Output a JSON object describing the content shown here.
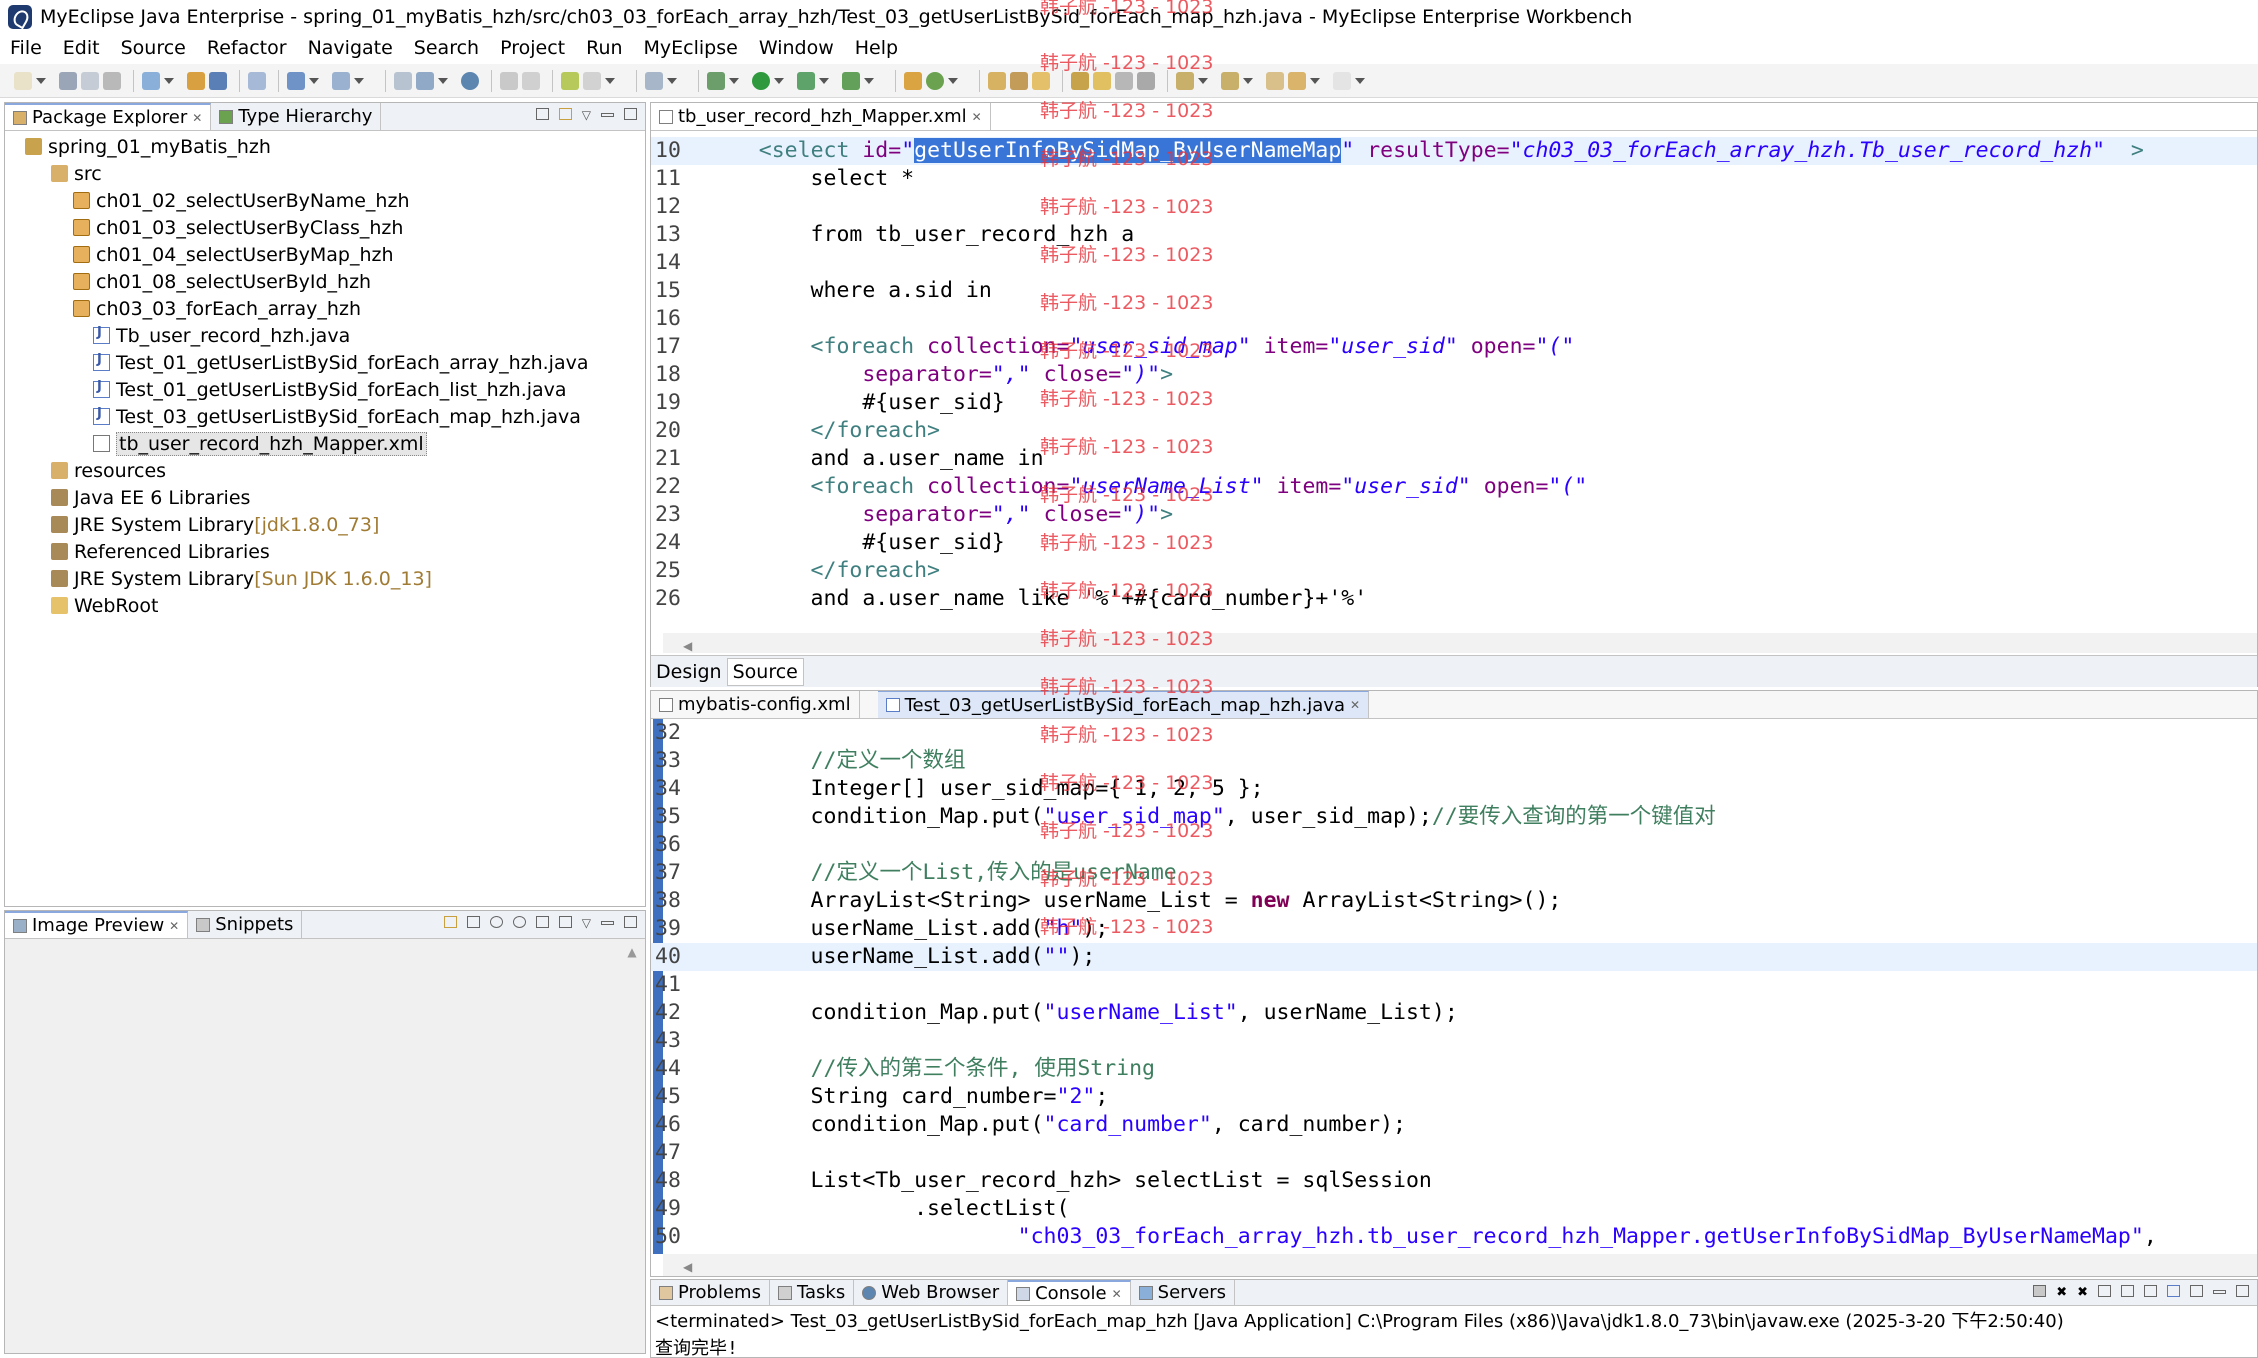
{
  "window": {
    "title": "MyEclipse Java Enterprise - spring_01_myBatis_hzh/src/ch03_03_forEach_array_hzh/Test_03_getUserListBySid_forEach_map_hzh.java - MyEclipse Enterprise Workbench"
  },
  "menu": [
    "File",
    "Edit",
    "Source",
    "Refactor",
    "Navigate",
    "Search",
    "Project",
    "Run",
    "MyEclipse",
    "Window",
    "Help"
  ],
  "explorer": {
    "tabs": [
      "Package Explorer",
      "Type Hierarchy"
    ],
    "tree": [
      {
        "label": "spring_01_myBatis_hzh",
        "extra": ""
      },
      {
        "label": "src",
        "extra": ""
      },
      {
        "label": "ch01_02_selectUserByName_hzh",
        "extra": ""
      },
      {
        "label": "ch01_03_selectUserByClass_hzh",
        "extra": ""
      },
      {
        "label": "ch01_04_selectUserByMap_hzh",
        "extra": ""
      },
      {
        "label": "ch01_08_selectUserById_hzh",
        "extra": ""
      },
      {
        "label": "ch03_03_forEach_array_hzh",
        "extra": ""
      },
      {
        "label": "Tb_user_record_hzh.java",
        "extra": ""
      },
      {
        "label": "Test_01_getUserListBySid_forEach_array_hzh.java",
        "extra": ""
      },
      {
        "label": "Test_01_getUserListBySid_forEach_list_hzh.java",
        "extra": ""
      },
      {
        "label": "Test_03_getUserListBySid_forEach_map_hzh.java",
        "extra": ""
      },
      {
        "label": "tb_user_record_hzh_Mapper.xml",
        "extra": ""
      },
      {
        "label": "resources",
        "extra": ""
      },
      {
        "label": "Java EE 6 Libraries",
        "extra": ""
      },
      {
        "label": "JRE System Library",
        "extra": " [jdk1.8.0_73]"
      },
      {
        "label": "Referenced Libraries",
        "extra": ""
      },
      {
        "label": "JRE System Library",
        "extra": " [Sun JDK 1.6.0_13]"
      },
      {
        "label": "WebRoot",
        "extra": ""
      }
    ]
  },
  "preview": {
    "tabs": [
      "Image Preview",
      "Snippets"
    ]
  },
  "xml_editor": {
    "tab": "tb_user_record_hzh_Mapper.xml",
    "bottom_tabs": [
      "Design",
      "Source"
    ],
    "lines": [
      {
        "n": "10",
        "segs": [
          [
            "",
            ""
          ],
          [
            "xtag",
            "    <"
          ],
          [
            "xtag",
            "select"
          ],
          [
            "xattr",
            " id="
          ],
          [
            "xval",
            "\""
          ],
          [
            "sel",
            "getUserInfoBySidMap_ByUserNameMap"
          ],
          [
            "xval",
            "\""
          ],
          [
            "xattr",
            " resultType="
          ],
          [
            "xval",
            "\"ch03_03_forEach_array_hzh.Tb_user_record_hzh\""
          ],
          [
            "xtag",
            "  >"
          ]
        ]
      },
      {
        "n": "11",
        "segs": [
          [
            "",
            "        select *"
          ]
        ]
      },
      {
        "n": "12",
        "segs": [
          [
            "",
            ""
          ]
        ]
      },
      {
        "n": "13",
        "segs": [
          [
            "",
            "        from tb_user_record_hzh a"
          ]
        ]
      },
      {
        "n": "14",
        "segs": [
          [
            "",
            ""
          ]
        ]
      },
      {
        "n": "15",
        "segs": [
          [
            "",
            "        where a.sid in"
          ]
        ]
      },
      {
        "n": "16",
        "segs": [
          [
            "",
            ""
          ]
        ]
      },
      {
        "n": "17",
        "segs": [
          [
            "xtag",
            "        <foreach"
          ],
          [
            "xattr",
            " collection="
          ],
          [
            "xval",
            "\"user_sid_map\""
          ],
          [
            "xattr",
            " item="
          ],
          [
            "xval",
            "\"user_sid\""
          ],
          [
            "xattr",
            " open="
          ],
          [
            "xval",
            "\"(\""
          ]
        ]
      },
      {
        "n": "18",
        "segs": [
          [
            "xattr",
            "            separator="
          ],
          [
            "xval",
            "\",\""
          ],
          [
            "xattr",
            " close="
          ],
          [
            "xval",
            "\")\""
          ],
          [
            "xtag",
            ">"
          ]
        ]
      },
      {
        "n": "19",
        "segs": [
          [
            "",
            "            #{user_sid}"
          ]
        ]
      },
      {
        "n": "20",
        "segs": [
          [
            "xtag",
            "        </foreach>"
          ]
        ]
      },
      {
        "n": "21",
        "segs": [
          [
            "",
            "        and a.user_name in"
          ]
        ]
      },
      {
        "n": "22",
        "segs": [
          [
            "xtag",
            "        <foreach"
          ],
          [
            "xattr",
            " collection="
          ],
          [
            "xval",
            "\"userName_List\""
          ],
          [
            "xattr",
            " item="
          ],
          [
            "xval",
            "\"user_sid\""
          ],
          [
            "xattr",
            " open="
          ],
          [
            "xval",
            "\"(\""
          ]
        ]
      },
      {
        "n": "23",
        "segs": [
          [
            "xattr",
            "            separator="
          ],
          [
            "xval",
            "\",\""
          ],
          [
            "xattr",
            " close="
          ],
          [
            "xval",
            "\")\""
          ],
          [
            "xtag",
            ">"
          ]
        ]
      },
      {
        "n": "24",
        "segs": [
          [
            "",
            "            #{user_sid}"
          ]
        ]
      },
      {
        "n": "25",
        "segs": [
          [
            "xtag",
            "        </foreach>"
          ]
        ]
      },
      {
        "n": "26",
        "segs": [
          [
            "",
            "        and a.user_name like '%'+#{card_number}+'%'"
          ]
        ]
      }
    ]
  },
  "java_editor": {
    "tabs": [
      "mybatis-config.xml",
      "Test_03_getUserListBySid_forEach_map_hzh.java"
    ],
    "lines": [
      {
        "n": "32",
        "segs": [
          [
            "",
            ""
          ]
        ]
      },
      {
        "n": "33",
        "segs": [
          [
            "",
            "        "
          ],
          [
            "cm",
            "//定义一个数组"
          ]
        ]
      },
      {
        "n": "34",
        "segs": [
          [
            "",
            "        Integer[] user_sid_map={ 1, 2, 5 };"
          ]
        ]
      },
      {
        "n": "35",
        "segs": [
          [
            "",
            "        condition_Map.put("
          ],
          [
            "str",
            "\"user_sid_map\""
          ],
          [
            "",
            ", user_sid_map);"
          ],
          [
            "cm",
            "//要传入查询的第一个键值对"
          ]
        ]
      },
      {
        "n": "36",
        "segs": [
          [
            "",
            ""
          ]
        ]
      },
      {
        "n": "37",
        "segs": [
          [
            "",
            "        "
          ],
          [
            "cm",
            "//定义一个List,传入的是userName"
          ]
        ]
      },
      {
        "n": "38",
        "segs": [
          [
            "",
            "        ArrayList<String> userName_List = "
          ],
          [
            "kw",
            "new"
          ],
          [
            "",
            " ArrayList<String>();"
          ]
        ]
      },
      {
        "n": "39",
        "segs": [
          [
            "",
            "        userName_List.add("
          ],
          [
            "str",
            "\"h\""
          ],
          [
            "",
            ");"
          ]
        ]
      },
      {
        "n": "40",
        "segs": [
          [
            "",
            "        userName_List.add("
          ],
          [
            "str",
            "\"\""
          ],
          [
            "",
            ");"
          ]
        ]
      },
      {
        "n": "41",
        "segs": [
          [
            "",
            ""
          ]
        ]
      },
      {
        "n": "42",
        "segs": [
          [
            "",
            "        condition_Map.put("
          ],
          [
            "str",
            "\"userName_List\""
          ],
          [
            "",
            ", userName_List);"
          ]
        ]
      },
      {
        "n": "43",
        "segs": [
          [
            "",
            ""
          ]
        ]
      },
      {
        "n": "44",
        "segs": [
          [
            "",
            "        "
          ],
          [
            "cm",
            "//传入的第三个条件, 使用String"
          ]
        ]
      },
      {
        "n": "45",
        "segs": [
          [
            "",
            "        String card_number="
          ],
          [
            "str",
            "\"2\""
          ],
          [
            "",
            ";"
          ]
        ]
      },
      {
        "n": "46",
        "segs": [
          [
            "",
            "        condition_Map.put("
          ],
          [
            "str",
            "\"card_number\""
          ],
          [
            "",
            ", card_number);"
          ]
        ]
      },
      {
        "n": "47",
        "segs": [
          [
            "",
            ""
          ]
        ]
      },
      {
        "n": "48",
        "segs": [
          [
            "",
            "        List<Tb_user_record_hzh> selectList = sqlSession"
          ]
        ]
      },
      {
        "n": "49",
        "segs": [
          [
            "",
            "                .selectList("
          ]
        ]
      },
      {
        "n": "50",
        "segs": [
          [
            "",
            "                        "
          ],
          [
            "str",
            "\"ch03_03_forEach_array_hzh.tb_user_record_hzh_Mapper.getUserInfoBySidMap_ByUserNameMap\""
          ],
          [
            "",
            ","
          ]
        ]
      }
    ]
  },
  "console": {
    "tabs": [
      "Problems",
      "Tasks",
      "Web Browser",
      "Console",
      "Servers"
    ],
    "status": "<terminated> Test_03_getUserListBySid_forEach_map_hzh [Java Application] C:\\Program Files (x86)\\Java\\jdk1.8.0_73\\bin\\javaw.exe (2025-3-20 下午2:50:40)",
    "output": "查询完毕!"
  },
  "watermark": "韩子航 -123 - 1023",
  "colors": {
    "selection": "#3875d7",
    "watermark": "#e8323a",
    "keyword": "#7f0055",
    "string": "#2a00ff",
    "comment": "#3f7f5f"
  }
}
